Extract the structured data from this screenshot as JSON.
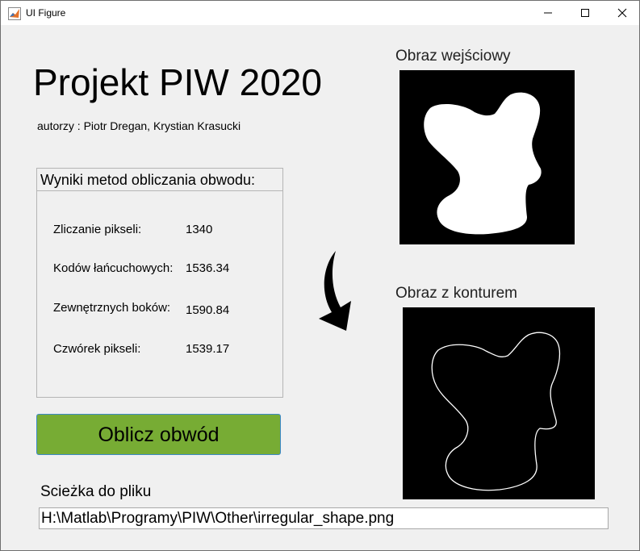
{
  "window": {
    "title": "UI Figure"
  },
  "header": {
    "title": "Projekt PIW 2020",
    "authors": "autorzy : Piotr Dregan, Krystian Krasucki"
  },
  "results": {
    "title": "Wyniki metod obliczania obwodu:",
    "rows": [
      {
        "label": "Zliczanie pikseli:",
        "value": "1340"
      },
      {
        "label": "Kodów łańcuchowych:",
        "value": "1536.34"
      },
      {
        "label": "Zewnętrznych boków:",
        "value": "1590.84"
      },
      {
        "label": "Czwórek pikseli:",
        "value": "1539.17"
      }
    ]
  },
  "compute_button": {
    "label": "Oblicz obwód",
    "color": "#77ac34"
  },
  "file": {
    "label": "Scieżka do pliku",
    "value": "H:\\Matlab\\Programy\\PIW\\Other\\irregular_shape.png"
  },
  "images": {
    "input_label": "Obraz wejściowy",
    "contour_label": "Obraz z konturem"
  }
}
